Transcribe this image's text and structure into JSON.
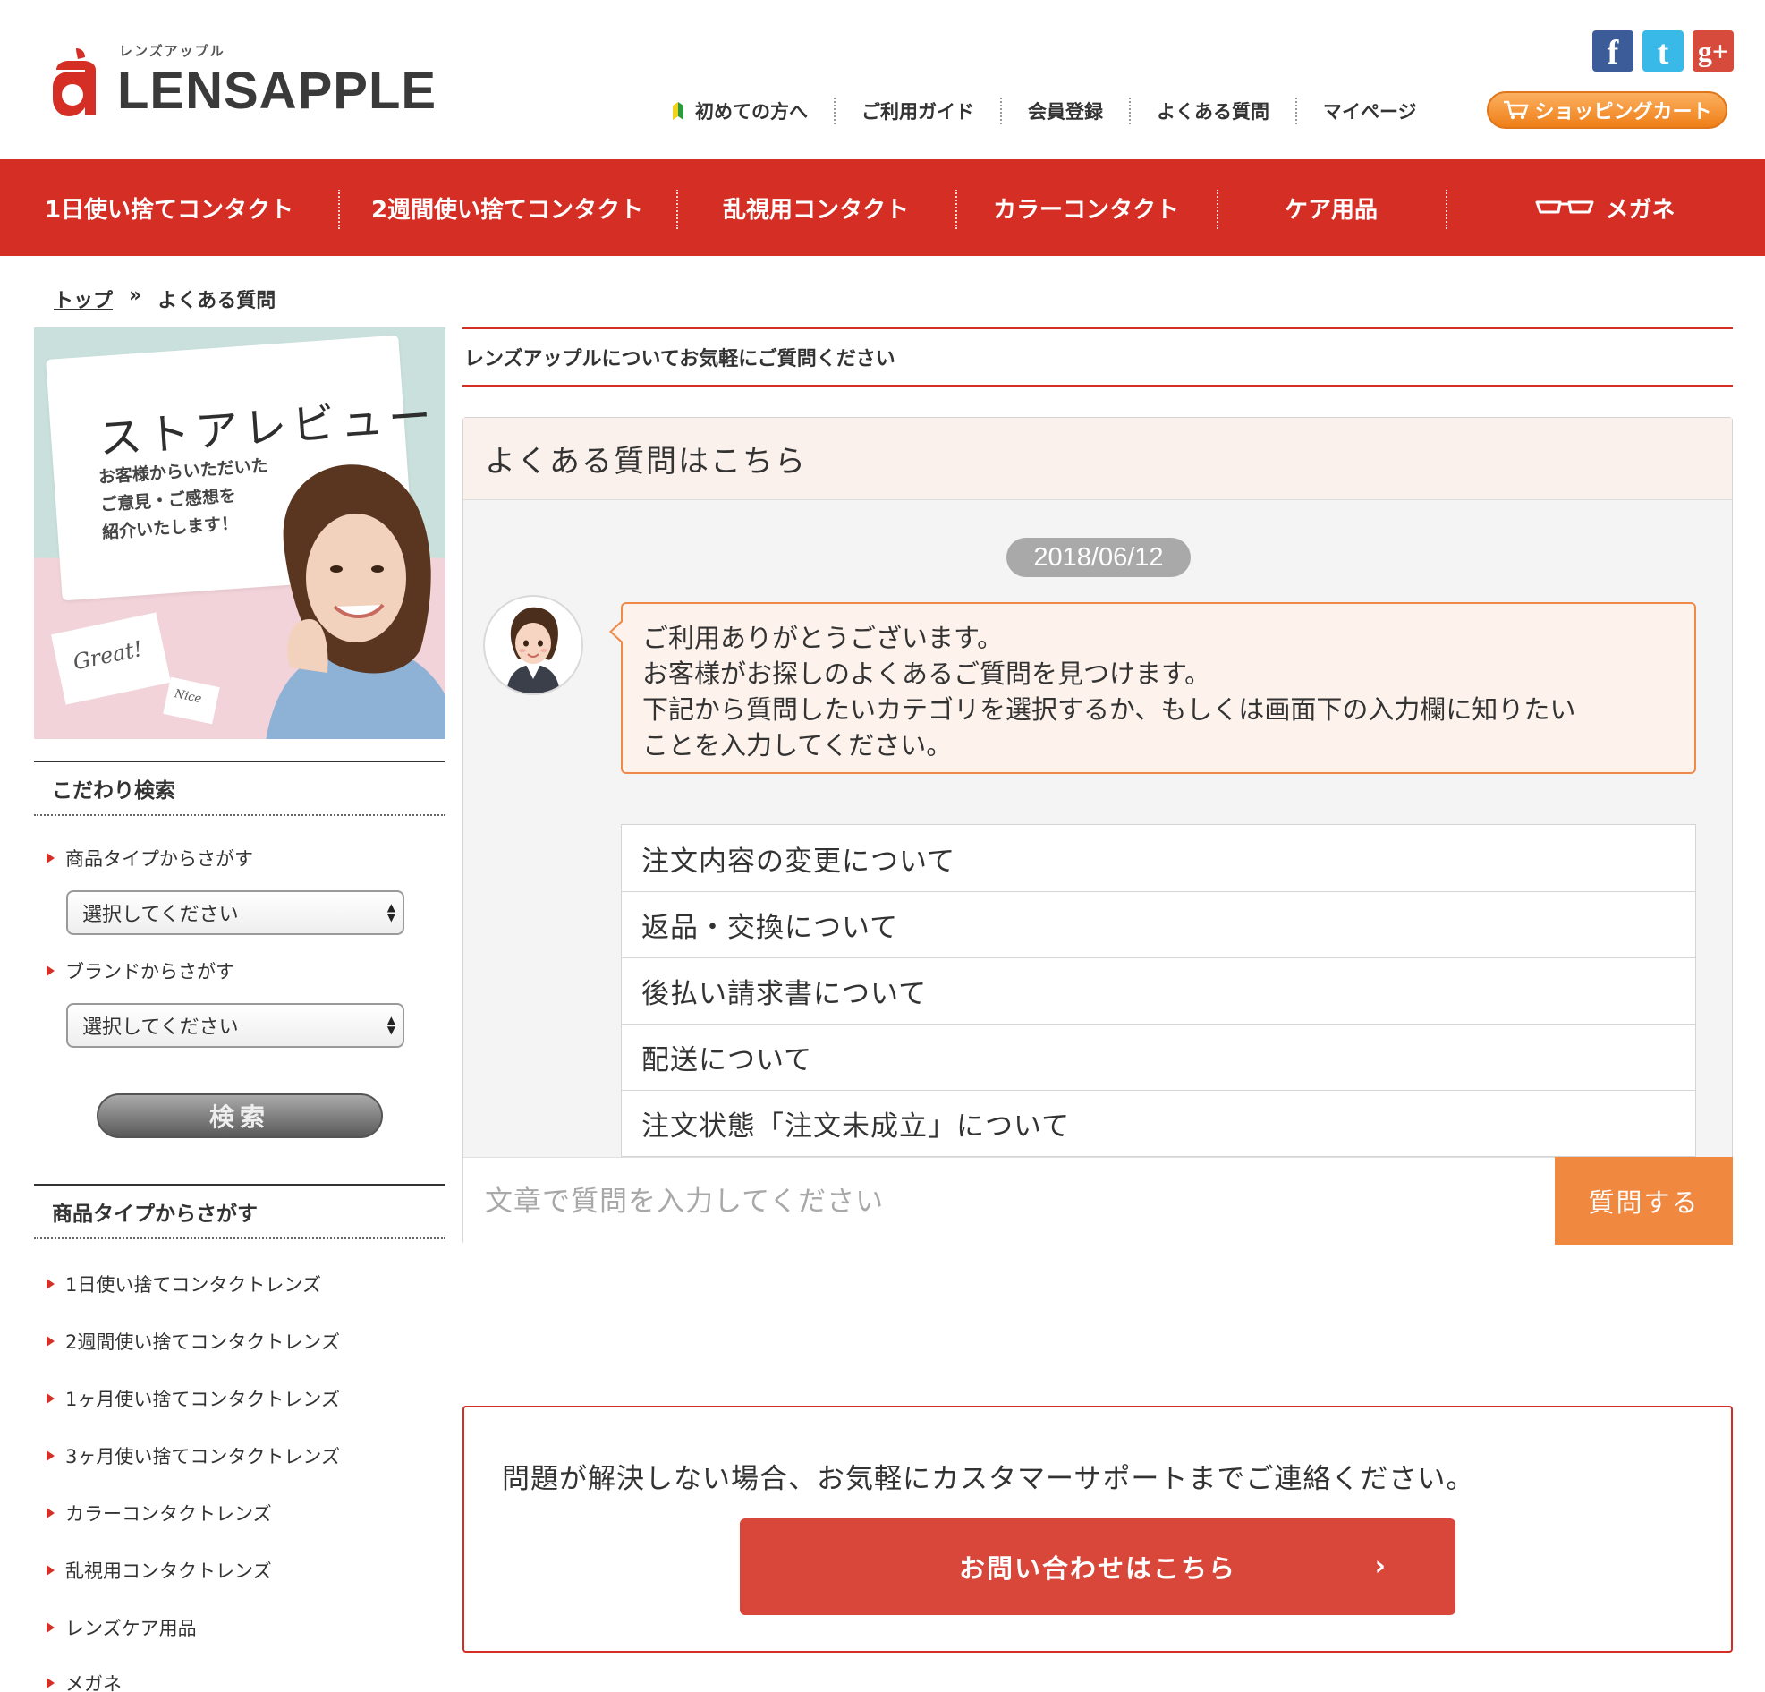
{
  "header": {
    "logo_kana": "レンズアップル",
    "logo_text": "LENSAPPLE",
    "social": [
      {
        "icon": "facebook-icon",
        "glyph": "f",
        "color": "#3b5c99"
      },
      {
        "icon": "twitter-icon",
        "glyph": "t",
        "color": "#38b9e8"
      },
      {
        "icon": "google-plus-icon",
        "glyph": "g+",
        "color": "#d64b3b"
      }
    ],
    "topnav": [
      "初めての方へ",
      "ご利用ガイド",
      "会員登録",
      "よくある質問",
      "マイページ"
    ],
    "cart_label": "ショッピングカート"
  },
  "catnav": [
    "1日使い捨てコンタクト",
    "2週間使い捨てコンタクト",
    "乱視用コンタクト",
    "カラーコンタクト",
    "ケア用品",
    "メガネ"
  ],
  "breadcrumb": {
    "home": "トップ",
    "separator": "»",
    "current": "よくある質問"
  },
  "banner": {
    "title": "ストアレビュー",
    "subtitle": "お客様からいただいた\nご意見・ご感想を\n紹介いたします！",
    "note1": "Great!",
    "note2": "Nice"
  },
  "sidebar": {
    "search_heading": "こだわり検索",
    "type_label": "商品タイプからさがす",
    "type_select": "選択してください",
    "brand_label": "ブランドからさがす",
    "brand_select": "選択してください",
    "search_button": "検索",
    "type_heading": "商品タイプからさがす",
    "type_links": [
      "1日使い捨てコンタクトレンズ",
      "2週間使い捨てコンタクトレンズ",
      "1ヶ月使い捨てコンタクトレンズ",
      "3ヶ月使い捨てコンタクトレンズ",
      "カラーコンタクトレンズ",
      "乱視用コンタクトレンズ",
      "レンズケア用品",
      "メガネ"
    ]
  },
  "main": {
    "title": "レンズアップルについてお気軽にご質問ください",
    "faq_heading": "よくある質問はこちら",
    "date": "2018/06/12",
    "bot_message": "ご利用ありがとうございます。\nお客様がお探しのよくあるご質問を見つけます。\n下記から質問したいカテゴリを選択するか、もしくは画面下の入力欄に知りたい\nことを入力してください。",
    "faq_items": [
      "注文内容の変更について",
      "返品・交換について",
      "後払い請求書について",
      "配送について",
      "注文状態「注文未成立」について"
    ],
    "input_placeholder": "文章で質問を入力してください",
    "ask_button": "質問する",
    "support_text": "問題が解決しない場合、お気軽にカスタマーサポートまでご連絡ください。",
    "support_button": "お問い合わせはこちら",
    "support_chevron": "›"
  },
  "colors": {
    "brand_red": "#d52e25",
    "accent_orange": "#f0883f",
    "bubble_bg": "#fdf2ec"
  }
}
